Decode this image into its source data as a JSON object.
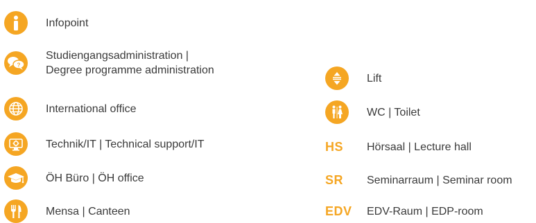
{
  "accent_color": "#f5a623",
  "left_items": [
    {
      "icon": "info-icon",
      "label": "Infopoint"
    },
    {
      "icon": "speech-bubbles-icon",
      "label_line1": "Studiengangsadministration |",
      "label_line2": "Degree programme administration"
    },
    {
      "icon": "globe-icon",
      "label": "International office"
    },
    {
      "icon": "monitor-gear-icon",
      "label": "Technik/IT | Technical support/IT"
    },
    {
      "icon": "graduation-cap-icon",
      "label": "ÖH Büro | ÖH office"
    },
    {
      "icon": "fork-knife-icon",
      "label": "Mensa | Canteen"
    }
  ],
  "right_items": [
    {
      "icon": "lift-icon",
      "label": "Lift"
    },
    {
      "icon": "toilet-icon",
      "label": "WC | Toilet"
    },
    {
      "abbr": "HS",
      "label": "Hörsaal | Lecture hall"
    },
    {
      "abbr": "SR",
      "label": "Seminarraum | Seminar room"
    },
    {
      "abbr": "EDV",
      "label": "EDV-Raum | EDP-room"
    }
  ]
}
